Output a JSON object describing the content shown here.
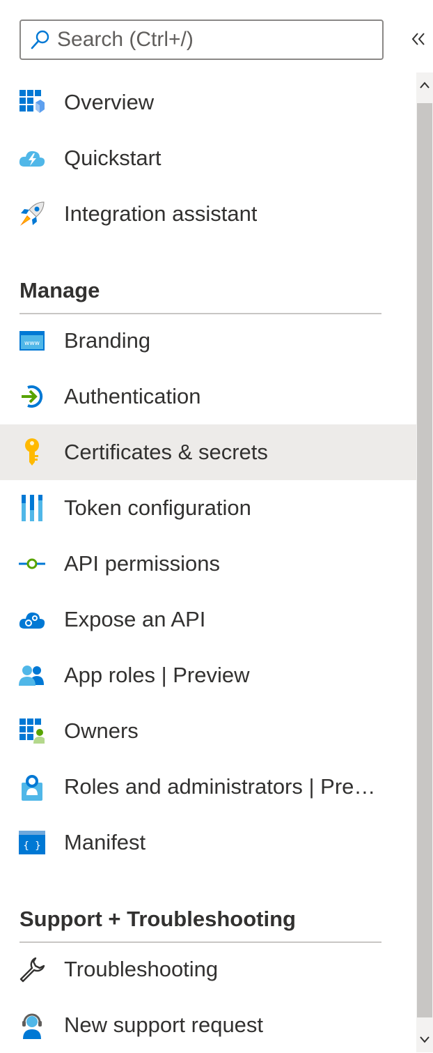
{
  "search": {
    "placeholder": "Search (Ctrl+/)",
    "icon": "search-icon"
  },
  "collapse": {
    "icon": "double-chevron-left-icon"
  },
  "nav_top": [
    {
      "label": "Overview",
      "icon": "overview-grid-icon"
    },
    {
      "label": "Quickstart",
      "icon": "quickstart-cloud-icon"
    },
    {
      "label": "Integration assistant",
      "icon": "rocket-icon"
    }
  ],
  "manage": {
    "title": "Manage",
    "items": [
      {
        "label": "Branding",
        "icon": "www-branding-icon"
      },
      {
        "label": "Authentication",
        "icon": "authentication-icon"
      },
      {
        "label": "Certificates & secrets",
        "icon": "key-icon",
        "selected": true
      },
      {
        "label": "Token configuration",
        "icon": "token-bars-icon"
      },
      {
        "label": "API permissions",
        "icon": "api-permissions-icon"
      },
      {
        "label": "Expose an API",
        "icon": "cloud-gear-icon"
      },
      {
        "label": "App roles | Preview",
        "icon": "app-roles-users-icon"
      },
      {
        "label": "Owners",
        "icon": "owners-icon"
      },
      {
        "label": "Roles and administrators | Preview",
        "icon": "roles-admin-icon"
      },
      {
        "label": "Manifest",
        "icon": "manifest-braces-icon"
      }
    ]
  },
  "support": {
    "title": "Support + Troubleshooting",
    "items": [
      {
        "label": "Troubleshooting",
        "icon": "wrench-icon"
      },
      {
        "label": "New support request",
        "icon": "support-agent-icon"
      }
    ]
  },
  "colors": {
    "selected_bg": "#edebe9",
    "accent": "#0078d4"
  }
}
